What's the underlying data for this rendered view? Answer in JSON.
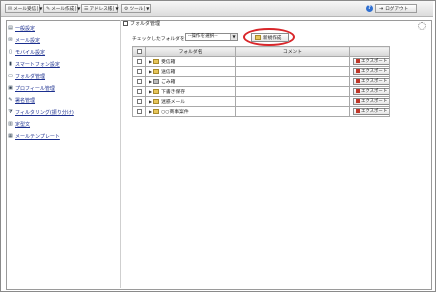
{
  "toolbar": {
    "buttons": [
      {
        "label": "メール受信"
      },
      {
        "label": "メール作成"
      },
      {
        "label": "アドレス帳"
      },
      {
        "label": "ツール"
      }
    ],
    "logout_label": "ログアウト"
  },
  "sidebar": {
    "items": [
      {
        "label": "一般設定",
        "icon": "settings-icon"
      },
      {
        "label": "メール設定",
        "icon": "mail-settings-icon"
      },
      {
        "label": "モバイル設定",
        "icon": "mobile-icon"
      },
      {
        "label": "スマートフォン設定",
        "icon": "smartphone-icon"
      },
      {
        "label": "フォルダ管理",
        "icon": "folder-icon"
      },
      {
        "label": "プロフィール管理",
        "icon": "profile-icon"
      },
      {
        "label": "署名管理",
        "icon": "pen-icon"
      },
      {
        "label": "フィルタリング(振り分け)",
        "icon": "filter-icon"
      },
      {
        "label": "定型文",
        "icon": "template-text-icon"
      },
      {
        "label": "メールテンプレート",
        "icon": "mail-template-icon"
      }
    ]
  },
  "main": {
    "title": "フォルダ管理",
    "checked_label": "チェックしたフォルダを",
    "action_select": "--操作を選択--",
    "new_button": "新規作成",
    "table": {
      "headers": [
        "フォルダ名",
        "コメント"
      ],
      "rows": [
        {
          "name": "受信箱",
          "icon": "inbox-folder",
          "comment": "",
          "export": "エクスポート"
        },
        {
          "name": "送信箱",
          "icon": "sent-folder",
          "comment": "",
          "export": "エクスポート"
        },
        {
          "name": "ごみ箱",
          "icon": "trash-folder",
          "comment": "",
          "export": "エクスポート"
        },
        {
          "name": "下書き保存",
          "icon": "draft-folder",
          "comment": "",
          "export": "エクスポート"
        },
        {
          "name": "迷惑メール",
          "icon": "spam-folder",
          "comment": "",
          "export": "エクスポート"
        },
        {
          "name": "○○商事案件",
          "icon": "custom-folder",
          "comment": "",
          "export": "エクスポート"
        }
      ]
    }
  }
}
